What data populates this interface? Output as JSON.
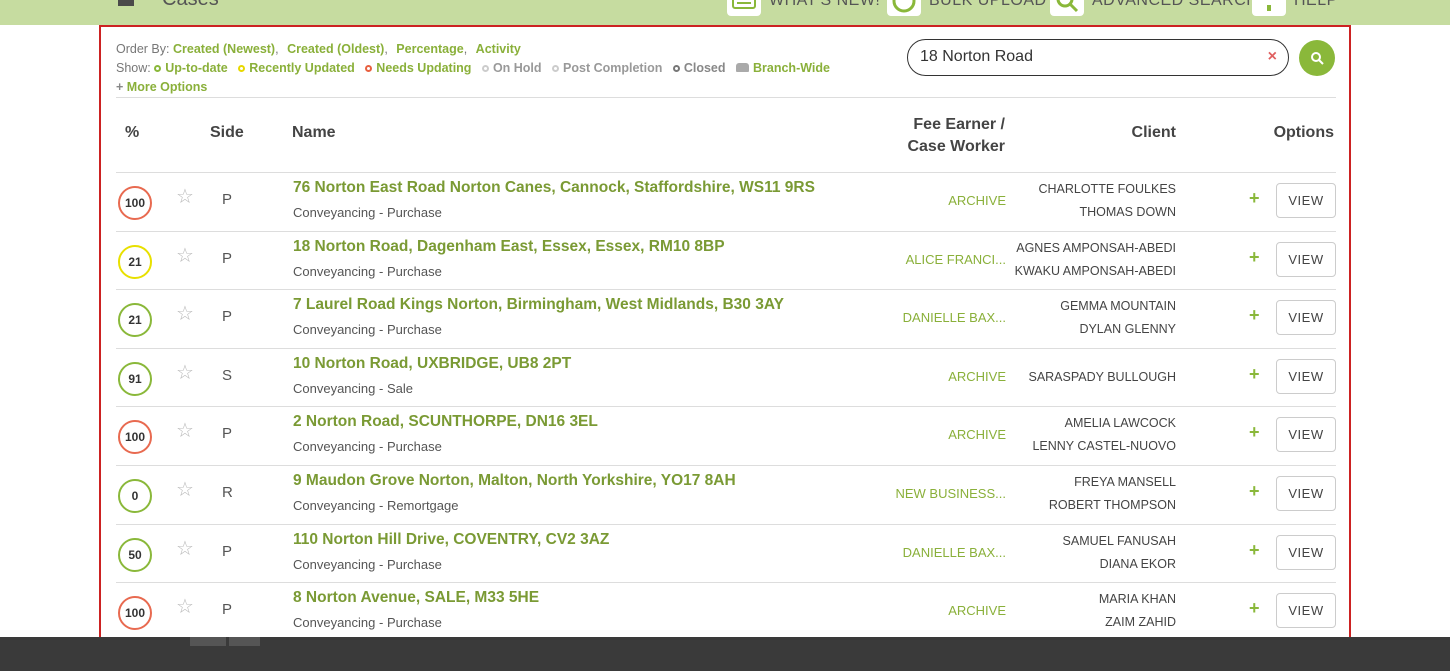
{
  "topbar": {
    "page_title": "Cases",
    "items": [
      {
        "label": "WHAT'S NEW!",
        "icon": "keyboard-icon"
      },
      {
        "label": "BULK UPLOAD",
        "icon": "upload-icon"
      },
      {
        "label": "ADVANCED SEARCH",
        "icon": "search-icon"
      },
      {
        "label": "HELP",
        "icon": "help-icon"
      }
    ]
  },
  "filters": {
    "order_by_label": "Order By:",
    "order_by": [
      "Created (Newest)",
      "Created (Oldest)",
      "Percentage",
      "Activity"
    ],
    "show_label": "Show:",
    "show": [
      {
        "label": "Up-to-date",
        "color": "#8ab83a",
        "text_color": "#8ab03a"
      },
      {
        "label": "Recently Updated",
        "color": "#e8d800",
        "text_color": "#8ab03a"
      },
      {
        "label": "Needs Updating",
        "color": "#e86040",
        "text_color": "#8ab03a"
      },
      {
        "label": "On Hold",
        "color": "#cccccc",
        "text_color": "#999999"
      },
      {
        "label": "Post Completion",
        "color": "#cccccc",
        "text_color": "#999999"
      },
      {
        "label": "Closed",
        "color": "#777777",
        "text_color": "#888888"
      },
      {
        "label": "Branch-Wide",
        "color": "#aaaaaa",
        "text_color": "#8ab03a"
      }
    ],
    "more_options": "More Options"
  },
  "search": {
    "value": "18 Norton Road",
    "clear": "×"
  },
  "table": {
    "headers": {
      "pct": "%",
      "side": "Side",
      "name": "Name",
      "fee_line1": "Fee Earner /",
      "fee_line2": "Case Worker",
      "client": "Client",
      "options": "Options"
    },
    "view_label": "VIEW",
    "rows": [
      {
        "pct": "100",
        "ring": "#e86a50",
        "side": "P",
        "address": "76 Norton East Road Norton Canes, Cannock, Staffordshire, WS11 9RS",
        "type": "Conveyancing - Purchase",
        "fee": "ARCHIVE",
        "clients": [
          "CHARLOTTE FOULKES",
          "THOMAS DOWN"
        ]
      },
      {
        "pct": "21",
        "ring": "#e8e000",
        "side": "P",
        "address": "18 Norton Road, Dagenham East, Essex, Essex, RM10 8BP",
        "type": "Conveyancing - Purchase",
        "fee": "ALICE FRANCI...",
        "clients": [
          "AGNES AMPONSAH-ABEDI",
          "KWAKU AMPONSAH-ABEDI"
        ]
      },
      {
        "pct": "21",
        "ring": "#8ab83a",
        "side": "P",
        "address": "7 Laurel Road Kings Norton, Birmingham, West Midlands, B30 3AY",
        "type": "Conveyancing - Purchase",
        "fee": "DANIELLE BAX...",
        "clients": [
          "GEMMA MOUNTAIN",
          "DYLAN GLENNY"
        ]
      },
      {
        "pct": "91",
        "ring": "#8ab83a",
        "side": "S",
        "address": "10 Norton Road, UXBRIDGE, UB8 2PT",
        "type": "Conveyancing - Sale",
        "fee": "ARCHIVE",
        "clients": [
          "SARASPADY BULLOUGH"
        ]
      },
      {
        "pct": "100",
        "ring": "#e86a50",
        "side": "P",
        "address": "2 Norton Road, SCUNTHORPE, DN16 3EL",
        "type": "Conveyancing - Purchase",
        "fee": "ARCHIVE",
        "clients": [
          "AMELIA LAWCOCK",
          "LENNY CASTEL-NUOVO"
        ]
      },
      {
        "pct": "0",
        "ring": "#8ab83a",
        "side": "R",
        "address": "9 Maudon Grove Norton, Malton, North Yorkshire, YO17 8AH",
        "type": "Conveyancing - Remortgage",
        "fee": "NEW BUSINESS...",
        "clients": [
          "FREYA MANSELL",
          "ROBERT THOMPSON"
        ]
      },
      {
        "pct": "50",
        "ring": "#8ab83a",
        "side": "P",
        "address": "110 Norton Hill Drive, COVENTRY, CV2 3AZ",
        "type": "Conveyancing - Purchase",
        "fee": "DANIELLE BAX...",
        "clients": [
          "SAMUEL FANUSAH",
          "DIANA EKOR"
        ]
      },
      {
        "pct": "100",
        "ring": "#e86a50",
        "side": "P",
        "address": "8 Norton Avenue, SALE, M33 5HE",
        "type": "Conveyancing - Purchase",
        "fee": "ARCHIVE",
        "clients": [
          "MARIA KHAN",
          "ZAIM ZAHID"
        ]
      }
    ]
  }
}
